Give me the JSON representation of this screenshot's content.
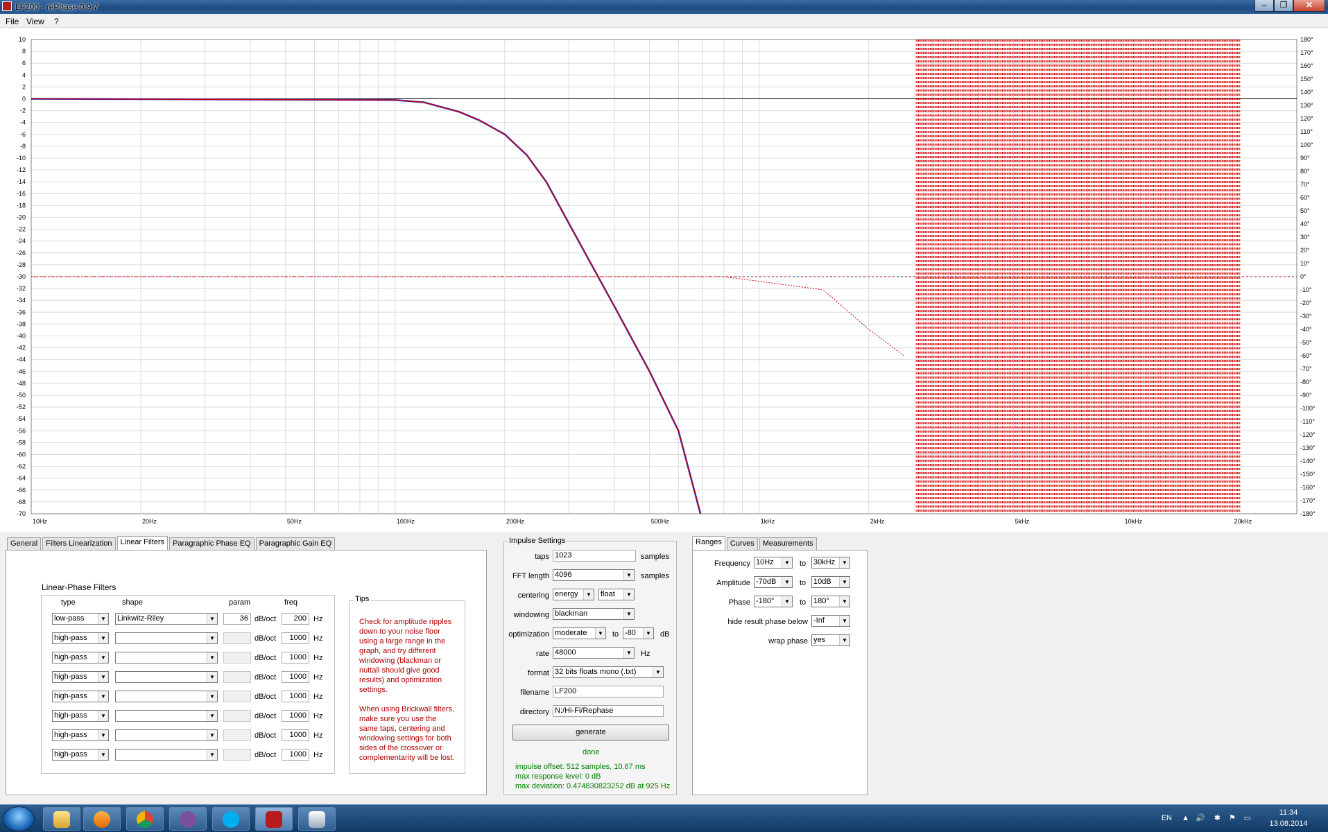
{
  "window": {
    "title": "LF200  -  rePhase 0.9.7"
  },
  "menu": {
    "file": "File",
    "view": "View",
    "help": "?"
  },
  "graph": {
    "amplitude_ticks": [
      "10",
      "8",
      "6",
      "4",
      "2",
      "0",
      "-2",
      "-4",
      "-6",
      "-8",
      "-10",
      "-12",
      "-14",
      "-16",
      "-18",
      "-20",
      "-22",
      "-24",
      "-26",
      "-28",
      "-30",
      "-32",
      "-34",
      "-36",
      "-38",
      "-40",
      "-42",
      "-44",
      "-46",
      "-48",
      "-50",
      "-52",
      "-54",
      "-56",
      "-58",
      "-60",
      "-62",
      "-64",
      "-66",
      "-68",
      "-70"
    ],
    "phase_ticks": [
      "180°",
      "170°",
      "160°",
      "150°",
      "140°",
      "130°",
      "120°",
      "110°",
      "100°",
      "90°",
      "80°",
      "70°",
      "60°",
      "50°",
      "40°",
      "30°",
      "20°",
      "10°",
      "0°",
      "-10°",
      "-20°",
      "-30°",
      "-40°",
      "-50°",
      "-60°",
      "-70°",
      "-80°",
      "-90°",
      "-100°",
      "-110°",
      "-120°",
      "-130°",
      "-140°",
      "-150°",
      "-160°",
      "-170°",
      "-180°"
    ],
    "frequency_ticks": [
      {
        "hz": 10,
        "label": "10Hz"
      },
      {
        "hz": 20,
        "label": "20Hz"
      },
      {
        "hz": 50,
        "label": "50Hz"
      },
      {
        "hz": 100,
        "label": "100Hz"
      },
      {
        "hz": 200,
        "label": "200Hz"
      },
      {
        "hz": 500,
        "label": "500Hz"
      },
      {
        "hz": 1000,
        "label": "1kHz"
      },
      {
        "hz": 2000,
        "label": "2kHz"
      },
      {
        "hz": 5000,
        "label": "5kHz"
      },
      {
        "hz": 10000,
        "label": "10kHz"
      },
      {
        "hz": 20000,
        "label": "20kHz"
      }
    ],
    "colors": {
      "result": "#d40000",
      "target": "#1f2cc8",
      "grid": "#dcdcdc",
      "zero": "#000000"
    }
  },
  "chart_data": {
    "type": "line",
    "xscale": "log",
    "xlim": [
      10,
      30000
    ],
    "ylim": [
      -70,
      10
    ],
    "y2lim": [
      -180,
      180
    ],
    "series": [],
    "points": {
      "magnitude_db": {
        "x": [
          10,
          100,
          120,
          150,
          170,
          200,
          230,
          260,
          300,
          400,
          500,
          600,
          690
        ],
        "y": [
          0,
          -0.2,
          -0.6,
          -2.2,
          -3.6,
          -6,
          -9.5,
          -14,
          -21,
          -35,
          -46,
          -56,
          -70
        ]
      },
      "phase_deg": {
        "x": [
          10,
          800,
          1500,
          2000,
          2500
        ],
        "y": [
          0,
          0,
          -10,
          -40,
          -60
        ]
      }
    },
    "grid": true
  },
  "tabs_left": [
    "General",
    "Filters Linearization",
    "Linear Filters",
    "Paragraphic Phase EQ",
    "Paragraphic Gain EQ"
  ],
  "linear_filters": {
    "title": "Linear-Phase Filters",
    "headers": {
      "type": "type",
      "shape": "shape",
      "param": "param",
      "freq": "freq"
    },
    "rows": [
      {
        "type": "low-pass",
        "shape": "Linkwitz-Riley",
        "param": "36",
        "unit": "dB/oct",
        "freq": "200",
        "hz": "Hz"
      },
      {
        "type": "high-pass",
        "shape": "",
        "param": "",
        "unit": "dB/oct",
        "freq": "1000",
        "hz": "Hz"
      },
      {
        "type": "high-pass",
        "shape": "",
        "param": "",
        "unit": "dB/oct",
        "freq": "1000",
        "hz": "Hz"
      },
      {
        "type": "high-pass",
        "shape": "",
        "param": "",
        "unit": "dB/oct",
        "freq": "1000",
        "hz": "Hz"
      },
      {
        "type": "high-pass",
        "shape": "",
        "param": "",
        "unit": "dB/oct",
        "freq": "1000",
        "hz": "Hz"
      },
      {
        "type": "high-pass",
        "shape": "",
        "param": "",
        "unit": "dB/oct",
        "freq": "1000",
        "hz": "Hz"
      },
      {
        "type": "high-pass",
        "shape": "",
        "param": "",
        "unit": "dB/oct",
        "freq": "1000",
        "hz": "Hz"
      },
      {
        "type": "high-pass",
        "shape": "",
        "param": "",
        "unit": "dB/oct",
        "freq": "1000",
        "hz": "Hz"
      }
    ]
  },
  "tips": {
    "title": "Tips",
    "text": "Check for amplitude ripples\ndown to your noise floor\nusing a large range in the\ngraph, and try different\nwindowing (blackman or\nnuttall should give good\nresults) and optimization\nsettings.\n\nWhen using Brickwall filters,\nmake sure you use the\nsame taps, centering and\nwindowing settings for both\nsides of the crossover or\ncomplementarity will be lost."
  },
  "impulse": {
    "title": "Impulse Settings",
    "taps_label": "taps",
    "taps": "1023",
    "samples": "samples",
    "fft_label": "FFT length",
    "fft": "4096",
    "centering_label": "centering",
    "centering": "energy",
    "float": "float",
    "windowing_label": "windowing",
    "windowing": "blackman",
    "optimization_label": "optimization",
    "optimization": "moderate",
    "to": "to",
    "opt_db": "-80",
    "db": "dB",
    "rate_label": "rate",
    "rate": "48000",
    "hz": "Hz",
    "format_label": "format",
    "format": "32 bits floats mono (.txt)",
    "filename_label": "filename",
    "filename": "LF200",
    "directory_label": "directory",
    "directory": "N:/Hi-Fi/Rephase",
    "generate": "generate",
    "done": "done",
    "offset": "impulse offset: 512 samples, 10.67 ms",
    "maxresp": "max response level: 0 dB",
    "maxdev": "max deviation: 0.474830823252 dB at 925 Hz"
  },
  "tabs_right": [
    "Ranges",
    "Curves",
    "Measurements"
  ],
  "ranges": {
    "frequency_label": "Frequency",
    "freq_from": "10Hz",
    "freq_to": "30kHz",
    "amplitude_label": "Amplitude",
    "amp_from": "-70dB",
    "amp_to": "10dB",
    "phase_label": "Phase",
    "phase_from": "-180°",
    "phase_to": "180°",
    "to": "to",
    "hide_label": "hide result phase below",
    "hide": "-Inf",
    "wrap_label": "wrap phase",
    "wrap": "yes"
  },
  "taskbar": {
    "lang": "EN",
    "time": "11:34",
    "date": "13.08.2014"
  }
}
